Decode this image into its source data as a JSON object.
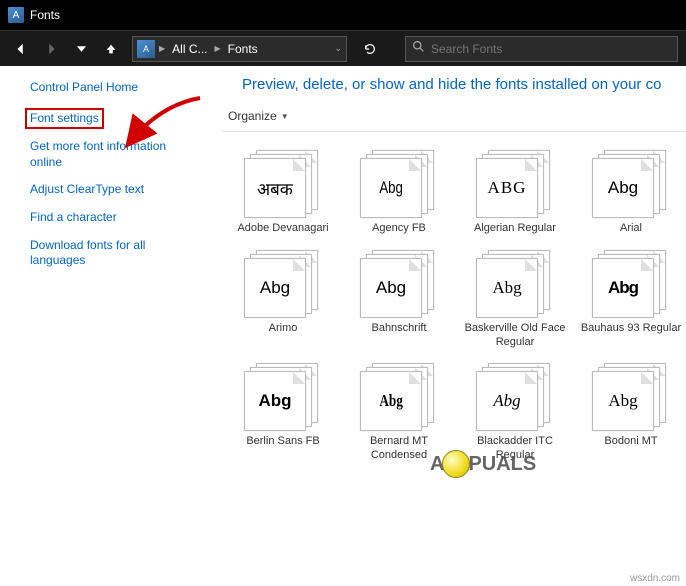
{
  "titlebar": {
    "title": "Fonts"
  },
  "navbar": {
    "path_seg1": "All C...",
    "path_seg2": "Fonts",
    "search_placeholder": "Search Fonts"
  },
  "sidebar": {
    "home": "Control Panel Home",
    "font_settings": "Font settings",
    "more_info": "Get more font information online",
    "cleartype": "Adjust ClearType text",
    "find_char": "Find a character",
    "download": "Download fonts for all languages"
  },
  "main": {
    "heading": "Preview, delete, or show and hide the fonts installed on your co",
    "organize_label": "Organize"
  },
  "fonts": [
    {
      "sample": "अबक",
      "label": "Adobe Devanagari",
      "style": "font-family:serif"
    },
    {
      "sample": "Abg",
      "label": "Agency FB",
      "style": "font-family:Arial;transform:scaleX(.78)"
    },
    {
      "sample": "ABG",
      "label": "Algerian Regular",
      "style": "font-family:serif;letter-spacing:1px;font-variant:small-caps"
    },
    {
      "sample": "Abg",
      "label": "Arial",
      "style": "font-family:Arial"
    },
    {
      "sample": "Abg",
      "label": "Arimo",
      "style": "font-family:Arial"
    },
    {
      "sample": "Abg",
      "label": "Bahnschrift",
      "style": "font-family:Arial"
    },
    {
      "sample": "Abg",
      "label": "Baskerville Old Face Regular",
      "style": "font-family:'Times New Roman',serif"
    },
    {
      "sample": "Abg",
      "label": "Bauhaus 93 Regular",
      "style": "font-family:Arial;font-weight:900;letter-spacing:-1px"
    },
    {
      "sample": "Abg",
      "label": "Berlin Sans FB",
      "style": "font-family:Arial;font-weight:600"
    },
    {
      "sample": "Abg",
      "label": "Bernard MT Condensed",
      "style": "font-family:serif;font-weight:900;transform:scaleX(.78)"
    },
    {
      "sample": "Abg",
      "label": "Blackadder ITC Regular",
      "style": "font-family:cursive;font-style:italic"
    },
    {
      "sample": "Abg",
      "label": "Bodoni MT",
      "style": "font-family:'Times New Roman',serif"
    }
  ],
  "watermark": "wsxdn.com",
  "logo_text_a": "A",
  "logo_text_b": "PUALS"
}
